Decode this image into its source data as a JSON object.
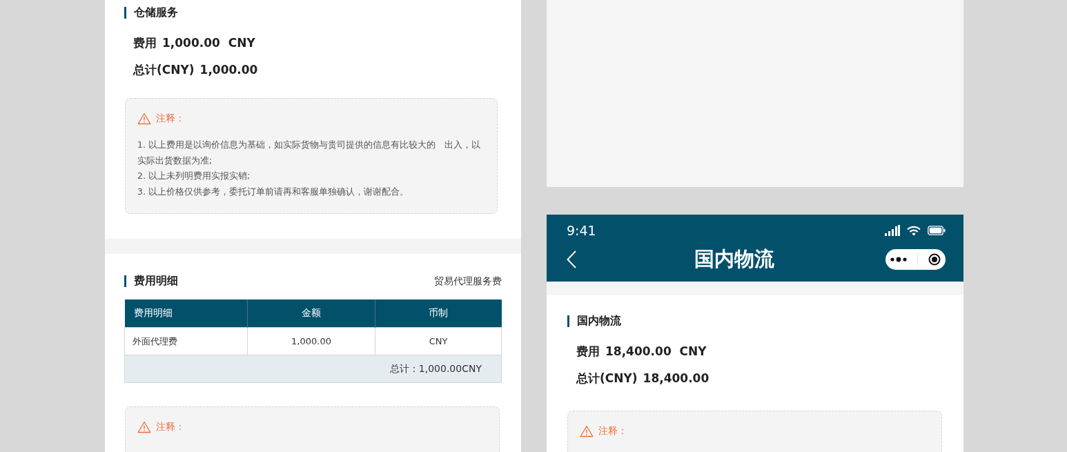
{
  "left_panel": {
    "storage_section": {
      "title": "仓储服务",
      "fee_label": "费用",
      "fee_value": "1,000.00  CNY",
      "total_label": "总计(CNY)",
      "total_value": "1,000.00",
      "note": {
        "title": "注释：",
        "lines": [
          "1. 以上费用是以询价信息为基础，如实际货物与贵司提供的信息有比较大的　出入，以实际出货数据为准;",
          "2. 以上未列明费用实报实销;",
          "3. 以上价格仅供参考，委托订单前请再和客服单独确认，谢谢配合。"
        ]
      }
    },
    "detail_section": {
      "title": "费用明细",
      "subtitle": "贸易代理服务费",
      "table": {
        "columns": [
          "费用明细",
          "金额",
          "币制"
        ],
        "rows": [
          [
            "外面代理费",
            "1,000.00",
            "CNY"
          ]
        ],
        "total": "总计：1,000.00CNY"
      },
      "note": {
        "title": "注释："
      }
    }
  },
  "phone": {
    "status_bar": {
      "time": "9:41"
    },
    "nav_bar": {
      "title": "国内物流"
    },
    "section": {
      "title": "国内物流",
      "fee_label": "费用",
      "fee_value": "18,400.00  CNY",
      "total_label": "总计(CNY)",
      "total_value": "18,400.00",
      "note": {
        "title": "注释："
      }
    }
  }
}
